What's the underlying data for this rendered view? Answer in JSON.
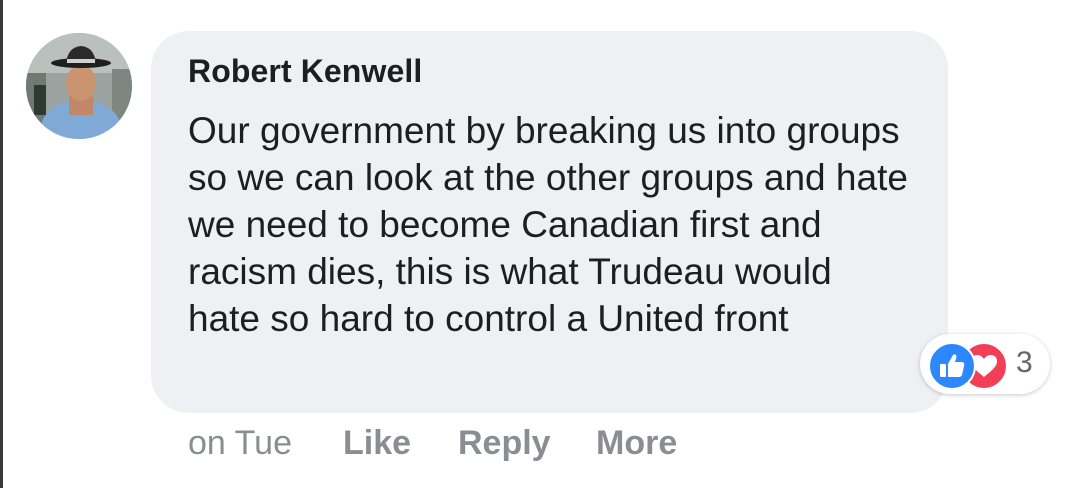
{
  "comment": {
    "author": "Robert Kenwell",
    "text": "Our government by breaking us into groups so we can look at the other groups and hate we need to become Canadian first and racism dies, this is what Trudeau would hate so hard to control a United front",
    "reactions": {
      "icons": [
        "like-icon",
        "love-icon"
      ],
      "count": "3"
    }
  },
  "actions": {
    "timestamp": "on Tue",
    "like_label": "Like",
    "reply_label": "Reply",
    "more_label": "More"
  },
  "colors": {
    "bubble": "#eff0f3",
    "text": "#1c1e21",
    "secondary_text": "#8a8d91",
    "like_blue": "#2d88ff",
    "love_red": "#f33e58"
  }
}
